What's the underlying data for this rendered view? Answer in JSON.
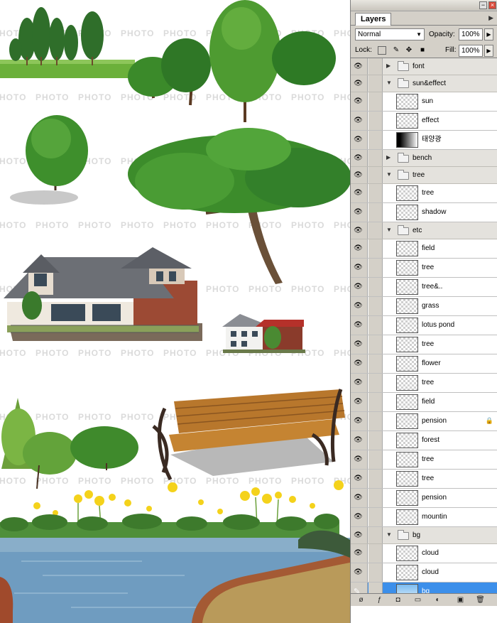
{
  "canvas": {
    "watermark_text": "PHOTO"
  },
  "panel": {
    "tab_label": "Layers",
    "blend_mode": "Normal",
    "opacity_label": "Opacity:",
    "opacity_value": "100%",
    "lock_label": "Lock:",
    "fill_label": "Fill:",
    "fill_value": "100%"
  },
  "layers": [
    {
      "name": "font",
      "kind": "group",
      "expanded": false,
      "visible": true
    },
    {
      "name": "sun&effect",
      "kind": "group",
      "expanded": true,
      "visible": true
    },
    {
      "name": "sun",
      "kind": "layer",
      "thumb": "checker",
      "visible": true
    },
    {
      "name": "effect",
      "kind": "layer",
      "thumb": "checker",
      "visible": true
    },
    {
      "name": "태양광",
      "kind": "layer",
      "thumb": "gradient",
      "visible": true
    },
    {
      "name": "bench",
      "kind": "group",
      "expanded": false,
      "visible": true
    },
    {
      "name": "tree",
      "kind": "group",
      "expanded": true,
      "visible": true
    },
    {
      "name": "tree",
      "kind": "layer",
      "thumb": "checker",
      "visible": true
    },
    {
      "name": "shadow",
      "kind": "layer",
      "thumb": "checker",
      "visible": true
    },
    {
      "name": "etc",
      "kind": "group",
      "expanded": true,
      "visible": true
    },
    {
      "name": "field",
      "kind": "layer",
      "thumb": "checker",
      "visible": true
    },
    {
      "name": "tree",
      "kind": "layer",
      "thumb": "checker",
      "visible": true
    },
    {
      "name": "tree&..",
      "kind": "layer",
      "thumb": "checker",
      "visible": true
    },
    {
      "name": "grass",
      "kind": "layer",
      "thumb": "checker",
      "visible": true
    },
    {
      "name": "lotus pond",
      "kind": "layer",
      "thumb": "checker",
      "visible": true
    },
    {
      "name": "tree",
      "kind": "layer",
      "thumb": "checker",
      "visible": true
    },
    {
      "name": "flower",
      "kind": "layer",
      "thumb": "checker",
      "visible": true
    },
    {
      "name": "tree",
      "kind": "layer",
      "thumb": "checker",
      "visible": true
    },
    {
      "name": "field",
      "kind": "layer",
      "thumb": "checker",
      "visible": true
    },
    {
      "name": "pension",
      "kind": "layer",
      "thumb": "checker",
      "visible": true,
      "locked": true
    },
    {
      "name": "forest",
      "kind": "layer",
      "thumb": "checker",
      "visible": true
    },
    {
      "name": "tree",
      "kind": "layer",
      "thumb": "checker",
      "visible": true
    },
    {
      "name": "tree",
      "kind": "layer",
      "thumb": "checker",
      "visible": true
    },
    {
      "name": "pension",
      "kind": "layer",
      "thumb": "checker",
      "visible": true
    },
    {
      "name": "mountin",
      "kind": "layer",
      "thumb": "checker",
      "visible": true
    },
    {
      "name": "bg",
      "kind": "group",
      "expanded": true,
      "visible": true
    },
    {
      "name": "cloud",
      "kind": "layer",
      "thumb": "checker",
      "visible": true
    },
    {
      "name": "cloud",
      "kind": "layer",
      "thumb": "checker",
      "visible": true
    },
    {
      "name": "bg",
      "kind": "layer",
      "thumb": "sky",
      "visible": false,
      "selected": true
    }
  ],
  "colors": {
    "selection": "#3c8fea",
    "panel_bg": "#d4d0c8",
    "tree_green": "#3f8f2a",
    "roof_gray": "#6c6f75",
    "brick": "#9c4a34",
    "bench_wood": "#b8772c",
    "water": "#6f9cc0",
    "flower_yellow": "#f4d21b"
  }
}
